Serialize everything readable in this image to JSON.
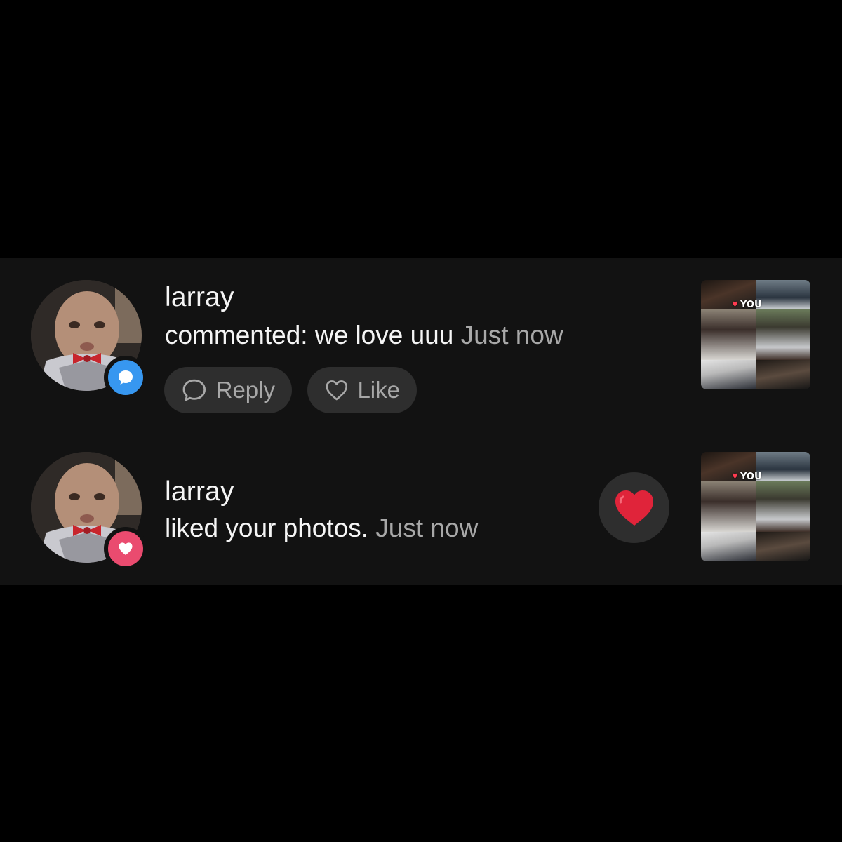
{
  "notifications": [
    {
      "username": "larray",
      "action_text": "commented: we love uuu",
      "time": "Just now",
      "badge_icon": "comment-icon",
      "badge_color": "#3797f0",
      "buttons": {
        "reply_label": "Reply",
        "like_label": "Like"
      },
      "thumbnail_tag": "YOU"
    },
    {
      "username": "larray",
      "action_text": "liked your photos.",
      "time": "Just now",
      "badge_icon": "heart-icon",
      "badge_color": "#ea4b6f",
      "reaction_icon": "red-heart-icon",
      "thumbnail_tag": "YOU"
    }
  ],
  "colors": {
    "background": "#000000",
    "panel": "#121212",
    "text_primary": "#f5f5f5",
    "text_secondary": "#a8a8a8",
    "pill_bg": "#2e2e2e",
    "reaction_heart": "#e0243a"
  }
}
